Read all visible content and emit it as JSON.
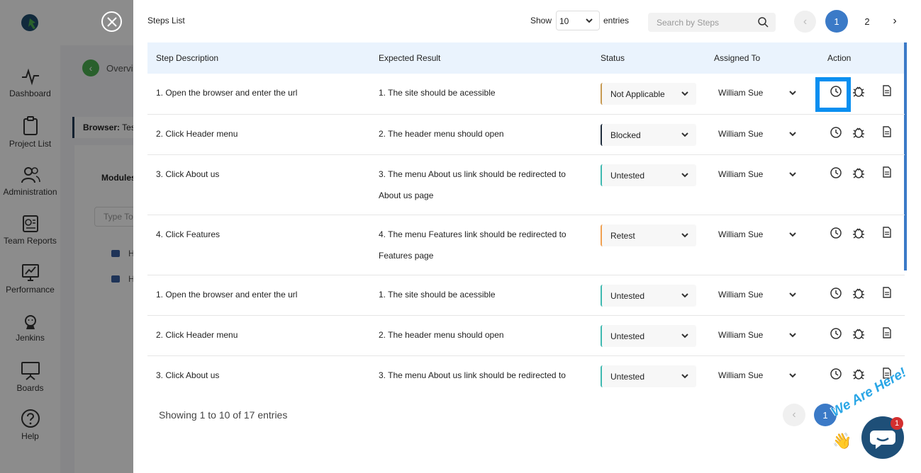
{
  "sidebar": {
    "items": [
      {
        "label": "Dashboard",
        "icon": "pulse-icon"
      },
      {
        "label": "Project List",
        "icon": "clipboard-icon"
      },
      {
        "label": "Administration",
        "icon": "users-icon"
      },
      {
        "label": "Team Reports",
        "icon": "report-icon"
      },
      {
        "label": "Performance",
        "icon": "performance-icon"
      },
      {
        "label": "Jenkins",
        "icon": "jenkins-icon"
      },
      {
        "label": "Boards",
        "icon": "board-icon"
      },
      {
        "label": "Help",
        "icon": "help-icon"
      }
    ]
  },
  "background": {
    "breadcrumb": "Overview",
    "browser_label": "Browser:",
    "browser_value": "Tes",
    "modules_title": "Modules",
    "modules_placeholder": "Type To",
    "folders": [
      "H",
      "H"
    ]
  },
  "modal": {
    "title": "Steps List",
    "show_label": "Show",
    "show_value": "10",
    "entries_label": "entries",
    "search_placeholder": "Search by Steps",
    "pagination": {
      "prev": "‹",
      "pages": [
        "1",
        "2"
      ],
      "next": "›"
    },
    "columns": [
      "Step Description",
      "Expected Result",
      "Status",
      "Assigned To",
      "Action"
    ],
    "rows": [
      {
        "desc": "1. Open the browser and enter the url",
        "expected": "1. The site should be acessible",
        "status": "Not Applicable",
        "assigned": "William Sue"
      },
      {
        "desc": "2. Click Header menu",
        "expected": "2. The header menu should open",
        "status": "Blocked",
        "assigned": "William Sue"
      },
      {
        "desc": "3. Click About us",
        "expected": "3. The menu About us link should be redirected to About us page",
        "status": "Untested",
        "assigned": "William Sue"
      },
      {
        "desc": "4. Click Features",
        "expected": "4. The menu Features link should be redirected to Features page",
        "status": "Retest",
        "assigned": "William Sue"
      },
      {
        "desc": "1. Open the browser and enter the url",
        "expected": "1. The site should be acessible",
        "status": "Untested",
        "assigned": "William Sue"
      },
      {
        "desc": "2. Click Header menu",
        "expected": "2. The header menu should open",
        "status": "Untested",
        "assigned": "William Sue"
      },
      {
        "desc": "3. Click About us",
        "expected": "3. The menu About us link should be redirected to",
        "status": "Untested",
        "assigned": "William Sue"
      }
    ],
    "footer_text": "Showing 1 to 10 of 17 entries",
    "footer_pagination": {
      "prev": "‹",
      "page": "1"
    }
  },
  "chat": {
    "badge": "1",
    "tagline": "We Are Here!"
  },
  "colors": {
    "primary": "#3b7ac7",
    "highlight": "#0a8ff0",
    "status_not_applicable": "#c79a52",
    "status_blocked": "#1f2d3d",
    "status_untested": "#3fb9b0",
    "status_retest": "#f0a050"
  }
}
